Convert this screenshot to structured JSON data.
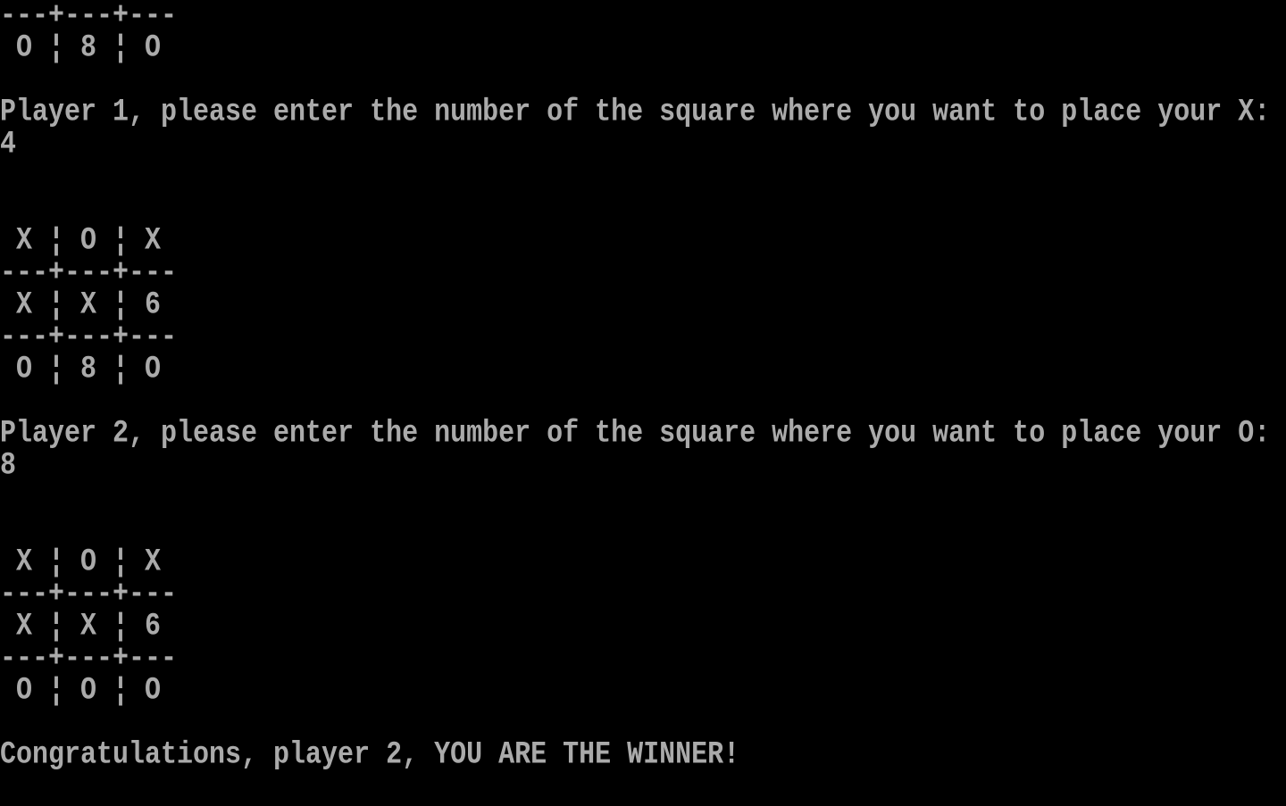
{
  "window": {
    "type": "text-console",
    "text_color": "#aaaaaa",
    "background_color": "#000000"
  },
  "lines": [
    "---+---+---",
    " O ¦ 8 ¦ O",
    "",
    "Player 1, please enter the number of the square where you want to place your X:",
    "4",
    "",
    "",
    " X ¦ O ¦ X",
    "---+---+---",
    " X ¦ X ¦ 6",
    "---+---+---",
    " O ¦ 8 ¦ O",
    "",
    "Player 2, please enter the number of the square where you want to place your O:",
    "8",
    "",
    "",
    " X ¦ O ¦ X",
    "---+---+---",
    " X ¦ X ¦ 6",
    "---+---+---",
    " O ¦ O ¦ O",
    "",
    "Congratulations, player 2, YOU ARE THE WINNER!",
    ""
  ],
  "game": {
    "previous_board_tail": {
      "row3": [
        "O",
        "8",
        "O"
      ]
    },
    "turns": [
      {
        "player": 1,
        "mark": "X",
        "prompt": "Player 1, please enter the number of the square where you want to place your X:",
        "input": "4",
        "board_after": [
          [
            "X",
            "O",
            "X"
          ],
          [
            "X",
            "X",
            "6"
          ],
          [
            "O",
            "8",
            "O"
          ]
        ]
      },
      {
        "player": 2,
        "mark": "O",
        "prompt": "Player 2, please enter the number of the square where you want to place your O:",
        "input": "8",
        "board_after": [
          [
            "X",
            "O",
            "X"
          ],
          [
            "X",
            "X",
            "6"
          ],
          [
            "O",
            "O",
            "O"
          ]
        ]
      }
    ],
    "result_message": "Congratulations, player 2, YOU ARE THE WINNER!",
    "cell_separator": "¦",
    "row_separator": "---+---+---"
  }
}
